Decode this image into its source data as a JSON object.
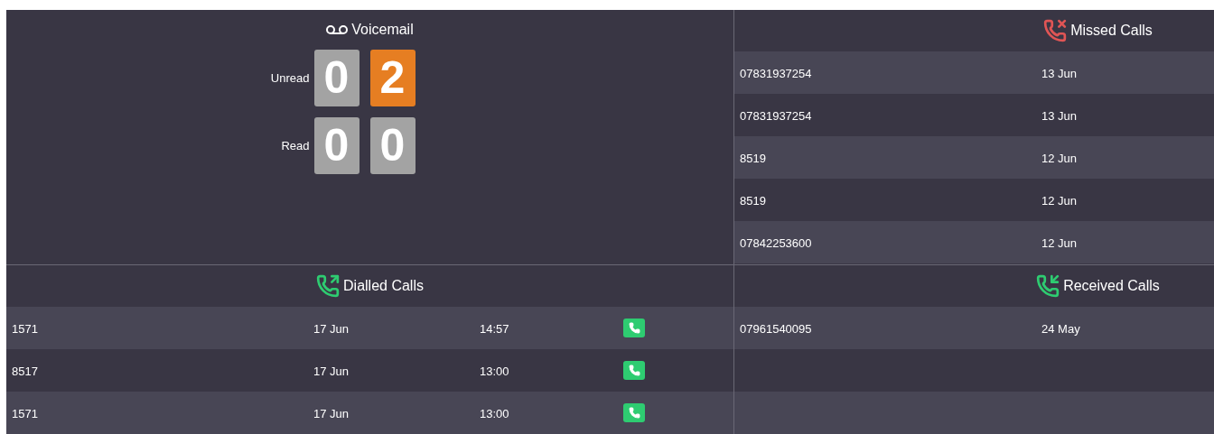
{
  "voicemail": {
    "title": "Voicemail",
    "rows": [
      {
        "label": "Unread",
        "digits": [
          {
            "value": "0",
            "highlighted": false
          },
          {
            "value": "2",
            "highlighted": true
          }
        ]
      },
      {
        "label": "Read",
        "digits": [
          {
            "value": "0",
            "highlighted": false
          },
          {
            "value": "0",
            "highlighted": false
          }
        ]
      }
    ]
  },
  "missed_calls": {
    "kind": "missed",
    "title": "Missed Calls",
    "rows": [
      {
        "number": "07831937254",
        "date": "13 Jun"
      },
      {
        "number": "07831937254",
        "date": "13 Jun"
      },
      {
        "number": "8519",
        "date": "12 Jun"
      },
      {
        "number": "8519",
        "date": "12 Jun"
      },
      {
        "number": "07842253600",
        "date": "12 Jun"
      }
    ]
  },
  "dialled_calls": {
    "kind": "dialled",
    "title": "Dialled Calls",
    "rows": [
      {
        "number": "1571",
        "date": "17 Jun",
        "time": "14:57"
      },
      {
        "number": "8517",
        "date": "17 Jun",
        "time": "13:00"
      },
      {
        "number": "1571",
        "date": "17 Jun",
        "time": "13:00"
      }
    ]
  },
  "received_calls": {
    "kind": "received",
    "title": "Received Calls",
    "rows": [
      {
        "number": "07961540095",
        "date": "24 May"
      }
    ]
  }
}
